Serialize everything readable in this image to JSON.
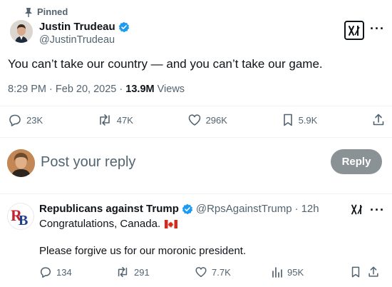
{
  "pinned": {
    "label": "Pinned"
  },
  "tweet": {
    "author_name": "Justin Trudeau",
    "author_handle": "@JustinTrudeau",
    "text": "You can’t take our country — and you can’t take our game.",
    "time": "8:29 PM",
    "date": "Feb 20, 2025",
    "views_count": "13.9M",
    "views_label": "Views",
    "separator": "·",
    "replies": "23K",
    "reposts": "47K",
    "likes": "296K",
    "bookmarks": "5.9K",
    "more": "···"
  },
  "composer": {
    "placeholder": "Post your reply",
    "reply_button": "Reply"
  },
  "reply": {
    "author_name": "Republicans against Trump",
    "author_handle": "@RpsAgainstTrump",
    "separator": "·",
    "age": "12h",
    "line1": "Congratulations, Canada.",
    "line2": "Please forgive us for our moronic president.",
    "replies": "134",
    "reposts": "291",
    "likes": "7.7K",
    "views": "95K",
    "more": "···"
  },
  "colors": {
    "verified": "#1d9bf0",
    "muted": "#536471",
    "text": "#0f1419",
    "reply_button": "#8b9296"
  },
  "icons": [
    "pin-icon",
    "verified-badge-icon",
    "grok-icon",
    "more-icon",
    "reply-icon",
    "repost-icon",
    "like-icon",
    "views-icon",
    "bookmark-icon",
    "share-icon",
    "canada-flag-icon"
  ]
}
